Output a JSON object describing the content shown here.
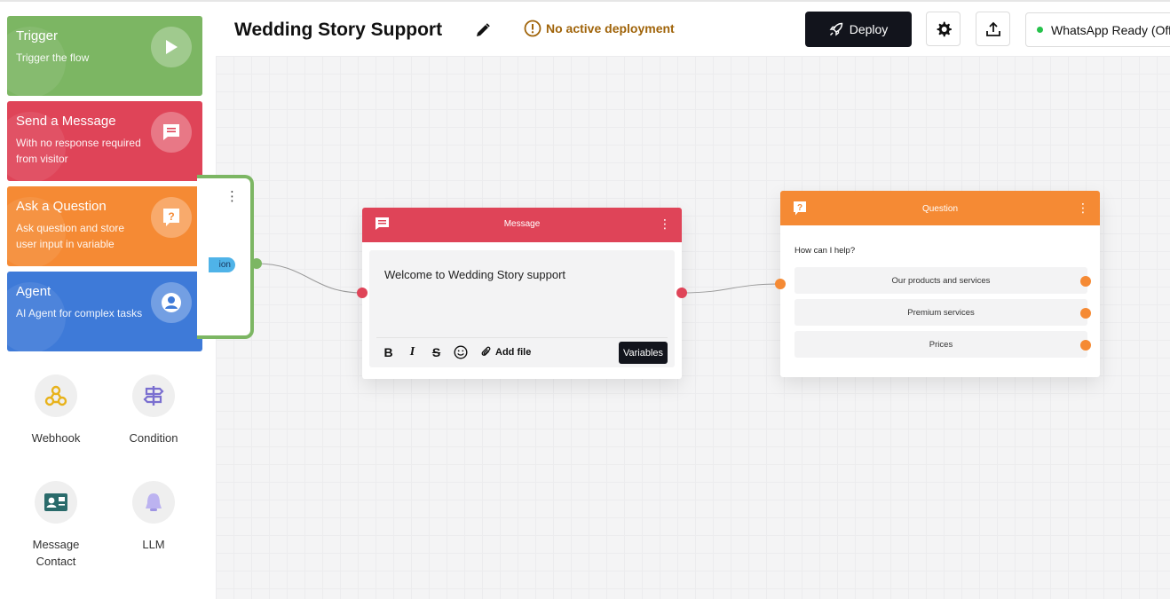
{
  "header": {
    "title": "Wedding Story Support",
    "deployment_warning": "No active deployment",
    "deploy_label": "Deploy",
    "whatsapp_status": "WhatsApp Ready (Off"
  },
  "sidebar": {
    "blocks": [
      {
        "title": "Trigger",
        "desc": "Trigger the flow",
        "color": "#7cb663",
        "icon": "play-icon"
      },
      {
        "title": "Send a Message",
        "desc": "With no response required from visitor",
        "color": "#df4458",
        "icon": "message-icon"
      },
      {
        "title": "Ask a Question",
        "desc": "Ask question and store user input in variable",
        "color": "#f58a34",
        "icon": "question-icon"
      },
      {
        "title": "Agent",
        "desc": "AI Agent for complex tasks",
        "color": "#3e7ad8",
        "icon": "user-icon"
      }
    ],
    "tools": [
      {
        "label": "Webhook",
        "icon": "webhook-icon"
      },
      {
        "label": "Condition",
        "icon": "signpost-icon"
      },
      {
        "label": "Message Contact",
        "icon": "contact-card-icon"
      },
      {
        "label": "LLM",
        "icon": "bell-icon"
      }
    ]
  },
  "canvas": {
    "trigger_node": {
      "tag": "ion"
    },
    "message_node": {
      "header": "Message",
      "text": "Welcome to Wedding Story support",
      "toolbar": {
        "bold": "B",
        "italic": "I",
        "strike": "S",
        "add_file": "Add file",
        "variables": "Variables"
      }
    },
    "question_node": {
      "header": "Question",
      "prompt": "How can I help?",
      "options": [
        "Our products and services",
        "Premium services",
        "Prices"
      ]
    }
  },
  "colors": {
    "trigger": "#7cb663",
    "message": "#df4458",
    "question": "#f58a34",
    "agent": "#3e7ad8",
    "dark": "#12141c",
    "warning": "#a0640a",
    "ready": "#27c24c"
  }
}
